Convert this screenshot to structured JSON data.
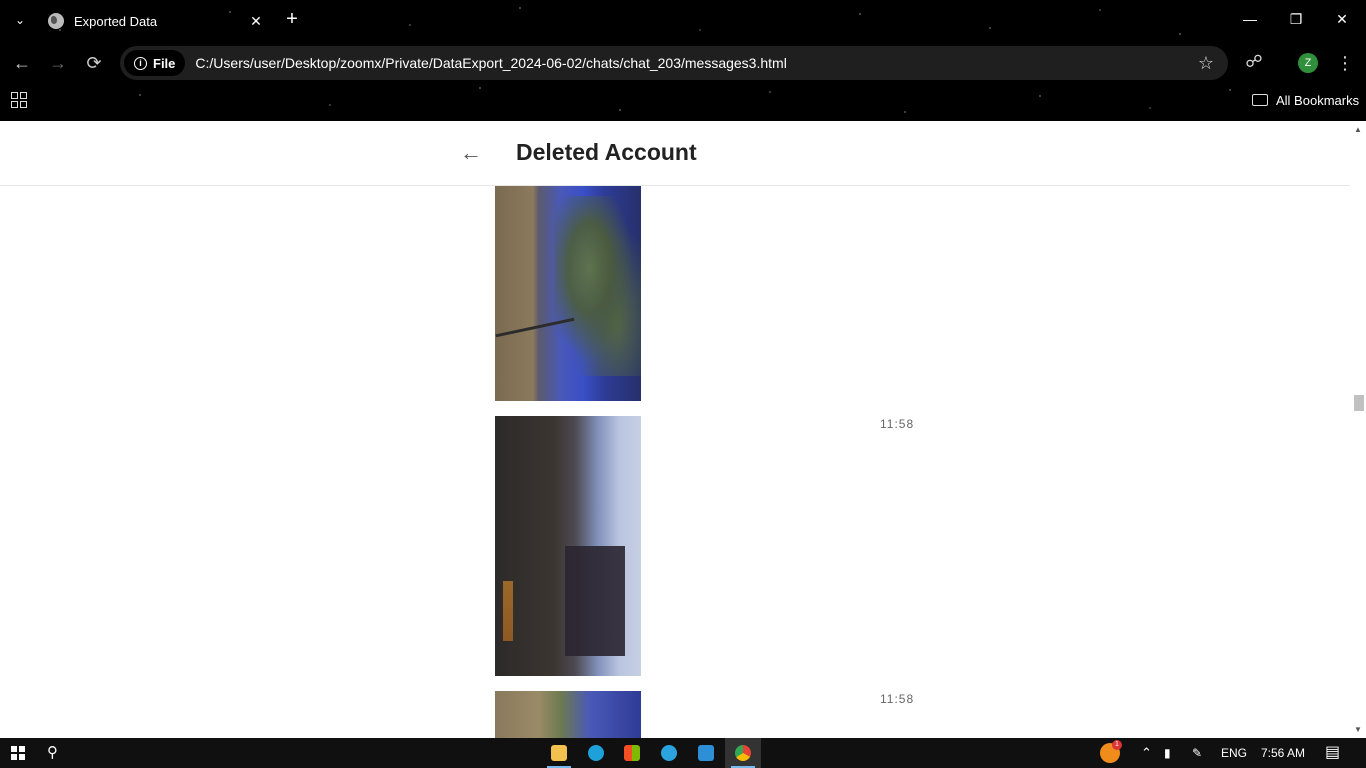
{
  "browser": {
    "tab": {
      "title": "Exported Data"
    },
    "address_bar": {
      "scheme_chip": "File",
      "url": "C:/Users/user/Desktop/zoomx/Private/DataExport_2024-06-02/chats/chat_203/messages3.html"
    },
    "profile_initial": "Z",
    "bookmarks_label": "All Bookmarks"
  },
  "chat": {
    "title": "Deleted Account",
    "messages": [
      {
        "type": "photo",
        "time": ""
      },
      {
        "type": "photo",
        "time": "11:58"
      },
      {
        "type": "photo",
        "time": "11:58"
      }
    ]
  },
  "taskbar": {
    "apps": [
      "file-explorer",
      "edge",
      "microsoft-store",
      "telegram",
      "vscode",
      "chrome"
    ],
    "weather_badge": "1",
    "language": "ENG",
    "clock": "7:56 AM"
  },
  "colors": {
    "chrome_bg": "#000000",
    "omnibox_bg": "#1f1f1f",
    "taskbar_bg": "#101010",
    "active_app_underline": "#76b9ed"
  }
}
